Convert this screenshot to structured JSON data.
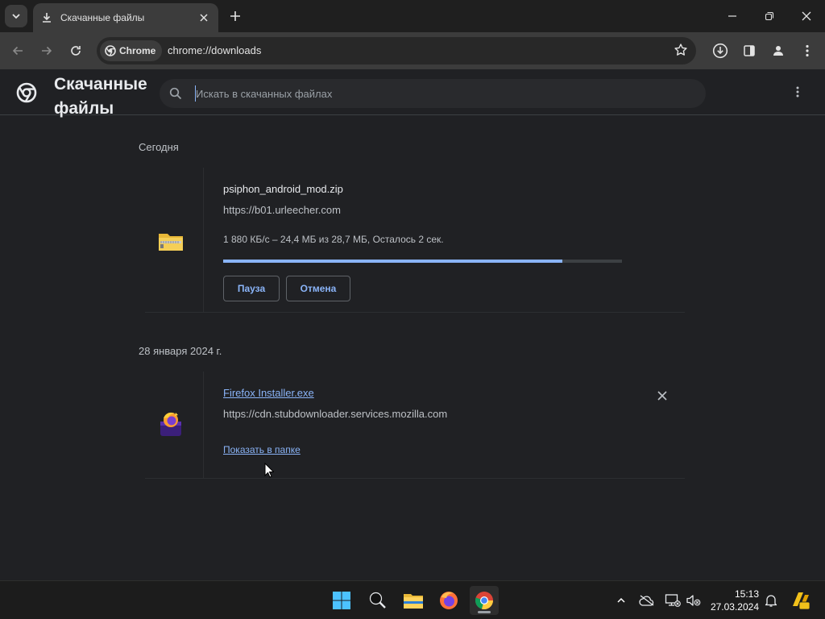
{
  "tab": {
    "title": "Скачанные файлы"
  },
  "toolbar": {
    "chip_label": "Chrome",
    "url": "chrome://downloads"
  },
  "page": {
    "title": "Скачанные файлы",
    "search_placeholder": "Искать в скачанных файлах"
  },
  "groups": [
    {
      "date": "Сегодня",
      "items": [
        {
          "filename": "psiphon_android_mod.zip",
          "url": "https://b01.urleecher.com",
          "status": "1 880 КБ/с – 24,4 МБ из 28,7 МБ, Осталось 2 сек.",
          "progress": 0.85,
          "pause_label": "Пауза",
          "cancel_label": "Отмена"
        }
      ]
    },
    {
      "date": "28 января 2024 г.",
      "items": [
        {
          "filename": "Firefox Installer.exe",
          "url": "https://cdn.stubdownloader.services.mozilla.com",
          "show_in_folder_label": "Показать в папке"
        }
      ]
    }
  ],
  "taskbar": {
    "time": "15:13",
    "date": "27.03.2024"
  },
  "colors": {
    "accent": "#8ab4f8",
    "background": "#202124",
    "toolbar": "#3c3c3c"
  }
}
